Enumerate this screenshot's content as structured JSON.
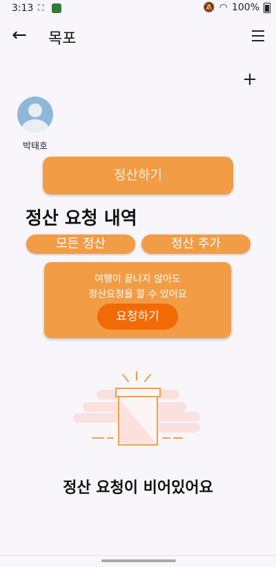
{
  "status_bar": {
    "time": "3:13",
    "battery": "100%"
  },
  "topbar": {
    "title": "목포"
  },
  "member": {
    "name": "박태호"
  },
  "buttons": {
    "settle": "정산하기",
    "all_settlements": "모든 정산",
    "add_settlement": "정산 추가",
    "request": "요청하기"
  },
  "section": {
    "title": "정산 요청 내역"
  },
  "request_card": {
    "line1": "여행이 끝나지 않아도",
    "line2": "정산요청을 할 수 있어요"
  },
  "empty": {
    "message": "정산 요청이 비어있어요"
  },
  "colors": {
    "primary": "#F39C46",
    "accent": "#F26A06",
    "background": "#F8F6FA"
  }
}
